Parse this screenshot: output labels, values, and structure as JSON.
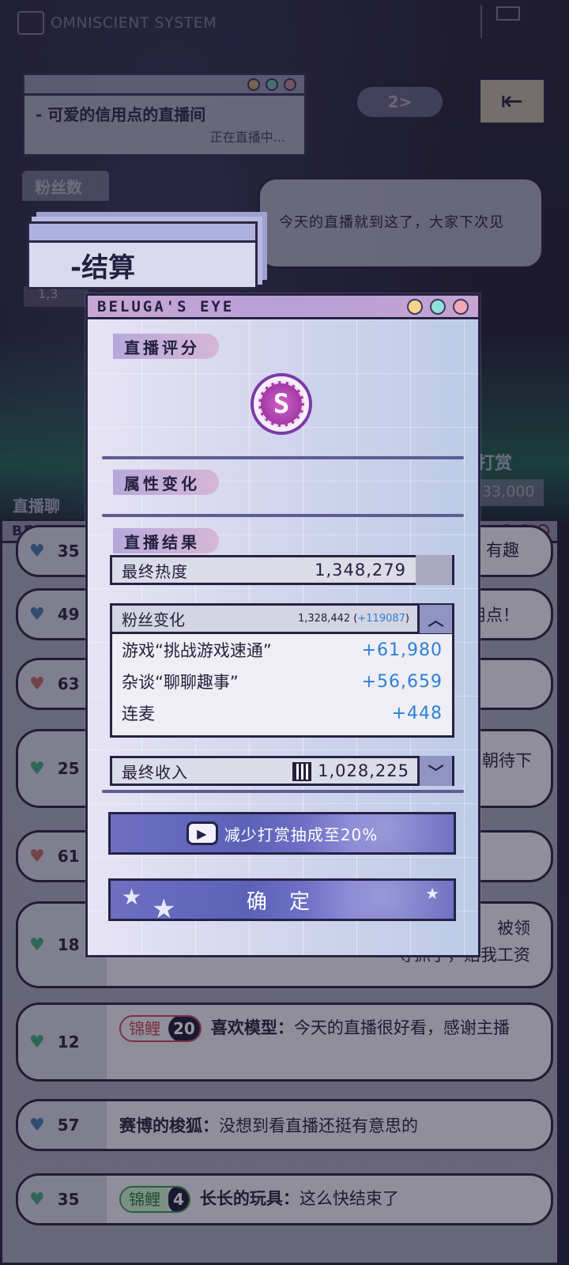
{
  "header": {
    "logo_text": "OMNISCIENT SYSTEM"
  },
  "background": {
    "stream_title": "- 可爱的信用点的直播间",
    "stream_status": "正在直播中...",
    "speed_label": "2>",
    "fans_label": "粉丝数",
    "fans_partial": "1,3",
    "bubble_text": "今天的直播就到这了，大家下次见",
    "settle_label": "-结算",
    "reward_label": "打赏",
    "reward_value": "33,000",
    "chat_label": "直播聊",
    "chat_window_title": "BELUGA'",
    "chat_rows": [
      {
        "rank": "35",
        "heart": "blue",
        "text": "有趣",
        "name": "",
        "badge": null
      },
      {
        "rank": "49",
        "heart": "blue",
        "text": "用点！",
        "name": "",
        "badge": null
      },
      {
        "rank": "63",
        "heart": "red",
        "text": "",
        "name": "",
        "badge": null
      },
      {
        "rank": "25",
        "heart": "green",
        "text": "朝待下",
        "name": "",
        "badge": null
      },
      {
        "rank": "61",
        "heart": "red",
        "text": "",
        "name": "",
        "badge": null
      },
      {
        "rank": "18",
        "heart": "green",
        "text": "被领\n导抓了，赔我工资",
        "name": "",
        "badge": null
      },
      {
        "rank": "12",
        "heart": "green",
        "name": "喜欢模型：",
        "text": "今天的直播很好看，感谢主播",
        "badge": {
          "name": "锦鲤",
          "level": "20",
          "style": "red"
        }
      },
      {
        "rank": "57",
        "heart": "blue",
        "name": "赛博的梭狐：",
        "text": "没想到看直播还挺有意思的",
        "badge": null
      },
      {
        "rank": "35",
        "heart": "green",
        "name": "长长的玩具：",
        "text": "这么快结束了",
        "badge": {
          "name": "锦鲤",
          "level": "4",
          "style": "green"
        }
      }
    ]
  },
  "modal": {
    "title": "BELUGA'S EYE",
    "section_score": "直播评分",
    "grade": "S",
    "section_attr": "属性变化",
    "section_result": "直播结果",
    "final_heat_label": "最终热度",
    "final_heat_value": "1,348,279",
    "fans_change_label": "粉丝变化",
    "fans_total": "1,328,442",
    "fans_delta": "+119087",
    "fans_items": [
      {
        "label": "游戏“挑战游戏速通”",
        "value": "+61,980"
      },
      {
        "label": "杂谈“聊聊趣事”",
        "value": "+56,659"
      },
      {
        "label": "连麦",
        "value": "+448"
      }
    ],
    "final_income_label": "最终收入",
    "final_income_value": "1,028,225",
    "boost_button": "减少打赏抽成至20%",
    "confirm_button": "确 定"
  },
  "colors": {
    "accent_blue": "#2e7fd6",
    "dark": "#262244",
    "grade_purple": "#a23aa5"
  }
}
